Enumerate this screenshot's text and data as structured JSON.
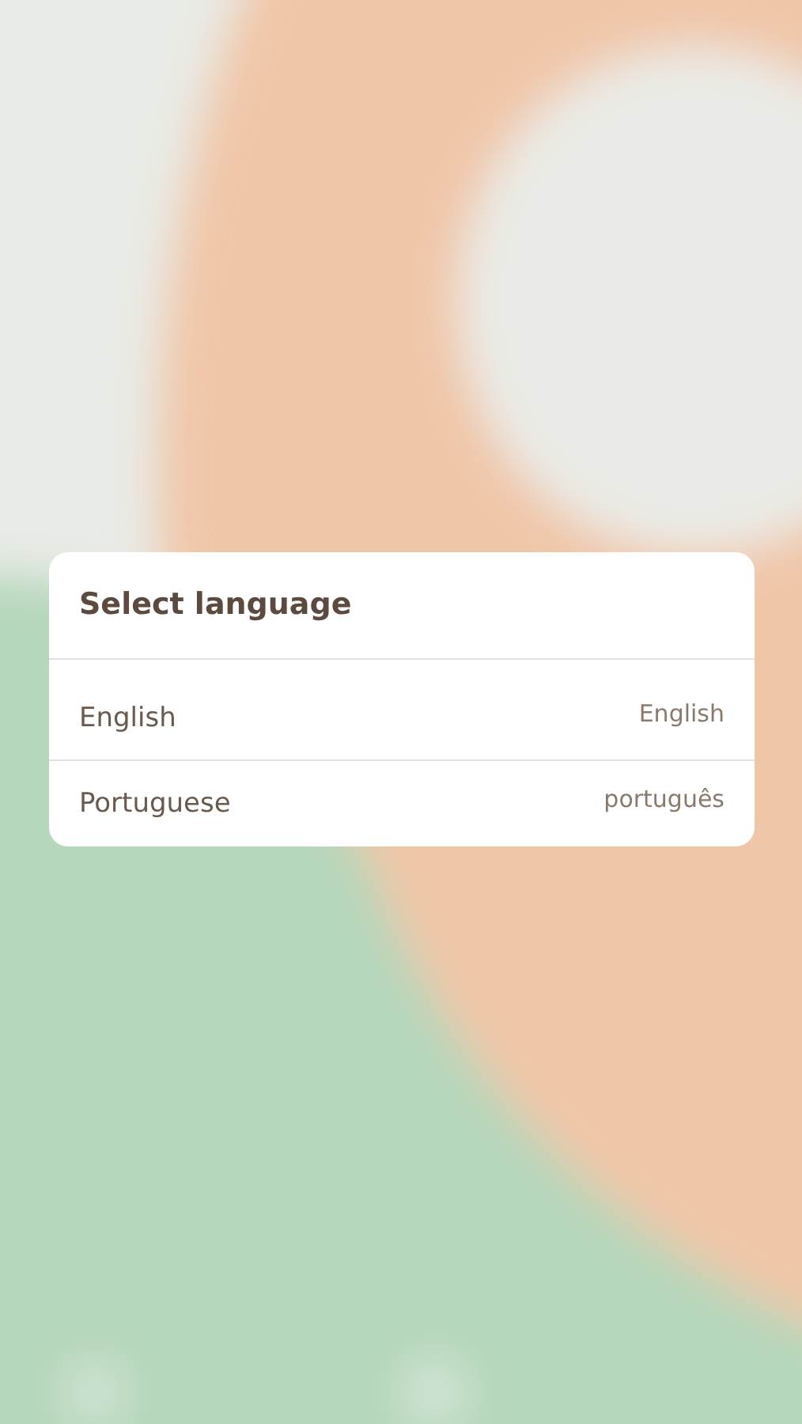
{
  "dialog": {
    "title": "Select language",
    "options": [
      {
        "name": "English",
        "native": "English"
      },
      {
        "name": "Portuguese",
        "native": "português"
      }
    ]
  }
}
